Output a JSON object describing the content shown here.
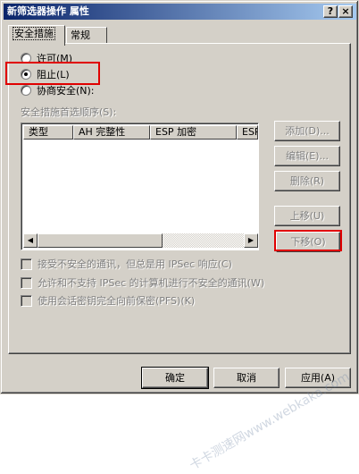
{
  "window": {
    "title": "新筛选器操作 属性",
    "help_label": "?",
    "close_label": "×"
  },
  "tabs": [
    {
      "label": "安全措施",
      "active": true
    },
    {
      "label": "常规",
      "active": false
    }
  ],
  "radios": [
    {
      "label": "许可(M)",
      "checked": false
    },
    {
      "label": "阻止(L)",
      "checked": true
    },
    {
      "label": "协商安全(N):",
      "checked": false
    }
  ],
  "list": {
    "caption": "安全措施首选顺序(S):",
    "columns": [
      "类型",
      "AH 完整性",
      "ESP 加密",
      "ESP"
    ]
  },
  "side_buttons": {
    "add": "添加(D)...",
    "edit": "编辑(E)...",
    "delete": "删除(R)",
    "move_up": "上移(U)",
    "move_down": "下移(O)"
  },
  "checkboxes": [
    {
      "label": "接受不安全的通讯，但总是用 IPSec 响应(C)",
      "checked": false
    },
    {
      "label": "允许和不支持 IPSec 的计算机进行不安全的通讯(W)",
      "checked": false
    },
    {
      "label": "使用会话密钥完全向前保密(PFS)(K)",
      "checked": false
    }
  ],
  "bottom_buttons": {
    "ok": "确定",
    "cancel": "取消",
    "apply": "应用(A)"
  },
  "watermark": "卡卡测速网www.webkaka.com"
}
